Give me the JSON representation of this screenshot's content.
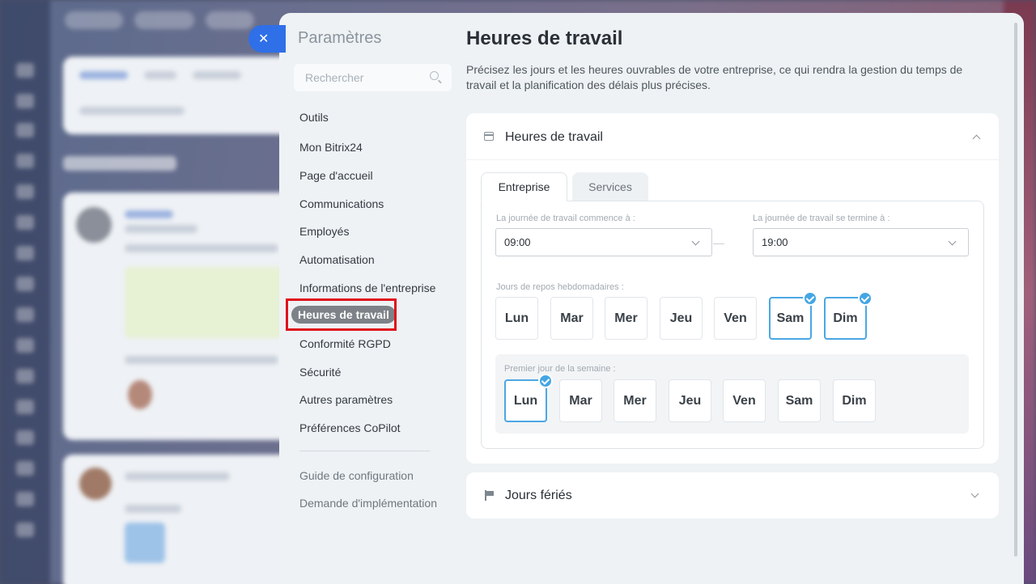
{
  "close_button": {
    "icon": "close-icon",
    "glyph": "✕"
  },
  "sidebar": {
    "title": "Paramètres",
    "search_placeholder": "Rechercher",
    "items": [
      {
        "label": "Outils"
      },
      {
        "label": "Mon Bitrix24"
      },
      {
        "label": "Page d'accueil"
      },
      {
        "label": "Communications"
      },
      {
        "label": "Employés"
      },
      {
        "label": "Automatisation"
      },
      {
        "label": "Informations de l'entreprise"
      },
      {
        "label": "Heures de travail",
        "active": true
      },
      {
        "label": "Conformité RGPD"
      },
      {
        "label": "Sécurité"
      },
      {
        "label": "Autres paramètres"
      },
      {
        "label": "Préférences CoPilot"
      }
    ],
    "secondary_items": [
      {
        "label": "Guide de configuration"
      },
      {
        "label": "Demande d'implémentation"
      }
    ]
  },
  "main": {
    "title": "Heures de travail",
    "description": "Précisez les jours et les heures ouvrables de votre entreprise, ce qui rendra la gestion du temps de travail et la planification des délais plus précises.",
    "working_hours_card": {
      "title": "Heures de travail",
      "icon": "calendar-icon",
      "tabs": [
        {
          "label": "Entreprise",
          "active": true
        },
        {
          "label": "Services",
          "active": false
        }
      ],
      "start_label": "La journée de travail commence à :",
      "start_value": "09:00",
      "end_label": "La journée de travail se termine à :",
      "end_value": "19:00",
      "weekly_rest_label": "Jours de repos hebdomadaires :",
      "weekly_rest_days": [
        {
          "label": "Lun",
          "checked": false
        },
        {
          "label": "Mar",
          "checked": false
        },
        {
          "label": "Mer",
          "checked": false
        },
        {
          "label": "Jeu",
          "checked": false
        },
        {
          "label": "Ven",
          "checked": false
        },
        {
          "label": "Sam",
          "checked": true
        },
        {
          "label": "Dim",
          "checked": true
        }
      ],
      "first_day_label": "Premier jour de la semaine :",
      "first_days": [
        {
          "label": "Lun",
          "checked": true
        },
        {
          "label": "Mar",
          "checked": false
        },
        {
          "label": "Mer",
          "checked": false
        },
        {
          "label": "Jeu",
          "checked": false
        },
        {
          "label": "Ven",
          "checked": false
        },
        {
          "label": "Sam",
          "checked": false
        },
        {
          "label": "Dim",
          "checked": false
        }
      ]
    },
    "holidays_card": {
      "title": "Jours fériés",
      "icon": "flag-icon"
    }
  },
  "colors": {
    "accent": "#2f6fe8",
    "check": "#44a6e4",
    "highlight_border": "#e0101a",
    "active_pill": "#7d8288"
  }
}
